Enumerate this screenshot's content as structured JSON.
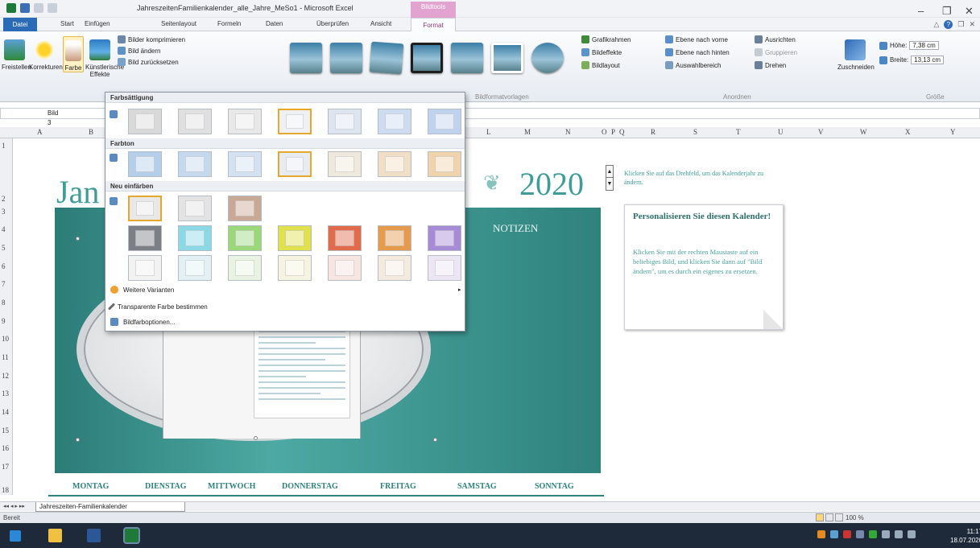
{
  "app": {
    "window_title": "JahreszeitenFamilienkalender_alle_Jahre_MeSo1  -  Microsoft Excel",
    "context_tab": "Bildtools",
    "tabs": [
      "Datei",
      "Start",
      "Einfügen",
      "Seitenlayout",
      "Formeln",
      "Daten",
      "Überprüfen",
      "Ansicht",
      "Format"
    ],
    "active_tab": "Format"
  },
  "ribbon": {
    "adjust": {
      "freistellen": "Freistellen",
      "korrekturen": "Korrekturen",
      "farbe": "Farbe",
      "effekte": "Künstlerische Effekte",
      "komprimieren": "Bilder komprimieren",
      "aendern": "Bild ändern",
      "zuruecksetzen": "Bild zurücksetzen"
    },
    "styles_group": "Bildformatvorlagen",
    "picture_options": {
      "rahmen": "Grafikrahmen",
      "effekte": "Bildeffekte",
      "layout": "Bildlayout"
    },
    "arrange": {
      "vorne": "Ebene nach vorne",
      "hinten": "Ebene nach hinten",
      "auswahl": "Auswahlbereich",
      "ausrichten": "Ausrichten",
      "gruppieren": "Gruppieren",
      "drehen": "Drehen",
      "group_label": "Anordnen"
    },
    "size": {
      "zuschneiden": "Zuschneiden",
      "hoehe_label": "Höhe:",
      "hoehe": "7,38 cm",
      "breite_label": "Breite:",
      "breite": "13,13 cm",
      "group_label": "Größe"
    }
  },
  "formula_bar": {
    "name_box": "Bild 3"
  },
  "columns": [
    "A",
    "B",
    "C",
    "D",
    "E",
    "F",
    "G",
    "H",
    "I",
    "J",
    "K",
    "L",
    "M",
    "N",
    "O",
    "P",
    "Q",
    "R",
    "S",
    "T",
    "U",
    "V",
    "W",
    "X",
    "Y"
  ],
  "rows": [
    "1",
    "2",
    "3",
    "4",
    "5",
    "6",
    "7",
    "8",
    "9",
    "10",
    "11",
    "12",
    "13",
    "14",
    "15",
    "16",
    "17",
    "18"
  ],
  "calendar": {
    "month": "Jan",
    "year": "2020",
    "year_hint": "Klicken Sie auf das Drehfeld, um das Kalenderjahr zu ändern.",
    "notes_title": "NOTIZEN",
    "tip_title": "Personalisieren Sie diesen Kalender!",
    "tip_body": "Klicken Sie mit der rechten Maustaste auf ein beliebiges Bild, und klicken Sie dann auf \"Bild ändern\", um es durch ein eigenes zu ersetzen.",
    "weekdays": [
      "MONTAG",
      "DIENSTAG",
      "MITTWOCH",
      "DONNERSTAG",
      "FREITAG",
      "SAMSTAG",
      "SONNTAG"
    ]
  },
  "color_menu": {
    "section_saturation": "Farbsättigung",
    "section_tone": "Farbton",
    "section_recolor": "Neu einfärben",
    "more_variations": "Weitere Varianten",
    "set_transparent": "Transparente Farbe bestimmen",
    "picture_color_options": "Bildfarboptionen...",
    "saturation_colors": [
      "#d9d9d9",
      "#e0e0e0",
      "#e8e8e8",
      "#eef0f3",
      "#dde6f0",
      "#cddcf0",
      "#bfd3ee"
    ],
    "tone_colors": [
      "#b5cfea",
      "#c5d9ee",
      "#d3e1f0",
      "#e7ecf2",
      "#efe8dc",
      "#f0dfc4",
      "#efd3ab"
    ],
    "recolor_row1": [
      "#e8e8e8",
      "#e3e3e3",
      "#c9a896"
    ],
    "recolor_row2": [
      "#7c7f86",
      "#8bd9e6",
      "#9ad87a",
      "#e0e14d",
      "#e06c4b",
      "#e69a4c",
      "#a78bd6"
    ],
    "recolor_row3": [
      "#f2f2f2",
      "#e3f1f4",
      "#e9f3e3",
      "#f6f4e0",
      "#f6e5e0",
      "#f5eadf",
      "#ece6f4"
    ],
    "selected_saturation": 3,
    "selected_tone": 3,
    "selected_recolor": 0
  },
  "sheet_tab": "Jahreszeiten-Familienkalender",
  "status": {
    "ready": "Bereit",
    "zoom": "100 %"
  },
  "clock": {
    "time": "11:17",
    "date": "18.07.2020"
  }
}
